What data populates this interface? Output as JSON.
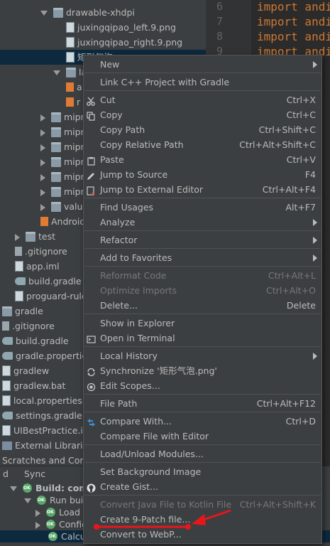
{
  "tree": {
    "rows": [
      {
        "text": "drawable-xhdpi",
        "indent": 57,
        "arrow": "down",
        "icon": "folder-icon"
      },
      {
        "text": "juxingqipao_left.9.png",
        "indent": 93,
        "arrow": "",
        "icon": "file-icon"
      },
      {
        "text": "juxingqipao_right.9.png",
        "indent": 93,
        "arrow": "",
        "icon": "file-icon"
      },
      {
        "text": "矩形气泡",
        "indent": 93,
        "arrow": "",
        "icon": "file-icon",
        "selected": true
      },
      {
        "text": "layout",
        "indent": 75,
        "arrow": "down",
        "icon": "folder-icon"
      },
      {
        "text": "a",
        "indent": 93,
        "arrow": "",
        "icon": "xml-file-icon"
      },
      {
        "text": "r",
        "indent": 93,
        "arrow": "",
        "icon": "xml-file-icon"
      },
      {
        "text": "mipmap",
        "indent": 57,
        "arrow": "right",
        "icon": "folder-icon"
      },
      {
        "text": "mipmap",
        "indent": 57,
        "arrow": "right",
        "icon": "folder-icon"
      },
      {
        "text": "mipmap",
        "indent": 57,
        "arrow": "right",
        "icon": "folder-icon"
      },
      {
        "text": "mipmap",
        "indent": 57,
        "arrow": "right",
        "icon": "folder-icon"
      },
      {
        "text": "mipmap",
        "indent": 57,
        "arrow": "right",
        "icon": "folder-icon"
      },
      {
        "text": "mipmap",
        "indent": 57,
        "arrow": "right",
        "icon": "folder-icon"
      },
      {
        "text": "values",
        "indent": 57,
        "arrow": "right",
        "icon": "folder-icon"
      },
      {
        "text": "AndroidManifest.xml",
        "indent": 57,
        "arrow": "",
        "icon": "manifest-icon"
      },
      {
        "text": "test",
        "indent": 21,
        "arrow": "right",
        "icon": "folder-icon"
      },
      {
        "text": ".gitignore",
        "indent": 21,
        "arrow": "",
        "icon": "git-file-icon"
      },
      {
        "text": "app.iml",
        "indent": 21,
        "arrow": "",
        "icon": "file-icon"
      },
      {
        "text": "build.gradle",
        "indent": 21,
        "arrow": "",
        "icon": "gradle-icon"
      },
      {
        "text": "proguard-rules.pro",
        "indent": 21,
        "arrow": "",
        "icon": "file-icon"
      },
      {
        "text": "gradle",
        "indent": 3,
        "arrow": "",
        "icon": "folder-icon"
      },
      {
        "text": ".gitignore",
        "indent": 3,
        "arrow": "",
        "icon": "git-file-icon"
      },
      {
        "text": "build.gradle",
        "indent": 3,
        "arrow": "",
        "icon": "gradle-icon"
      },
      {
        "text": "gradle.properties",
        "indent": 3,
        "arrow": "",
        "icon": "gradle-icon"
      },
      {
        "text": "gradlew",
        "indent": 3,
        "arrow": "",
        "icon": "file-icon"
      },
      {
        "text": "gradlew.bat",
        "indent": 3,
        "arrow": "",
        "icon": "file-icon"
      },
      {
        "text": "local.properties",
        "indent": 3,
        "arrow": "",
        "icon": "file-icon"
      },
      {
        "text": "settings.gradle",
        "indent": 3,
        "arrow": "",
        "icon": "gradle-icon"
      },
      {
        "text": "UIBestPractice.iml",
        "indent": 3,
        "arrow": "",
        "icon": "file-icon"
      },
      {
        "text": "External Libraries",
        "indent": 3,
        "arrow": "",
        "icon": "libraries-icon"
      },
      {
        "text": "Scratches and Consoles",
        "indent": 3,
        "arrow": "",
        "icon": ""
      }
    ]
  },
  "editor": {
    "lines": [
      {
        "num": "6",
        "code": "import andi"
      },
      {
        "num": "7",
        "code": "import andi"
      },
      {
        "num": "8",
        "code": "import andi"
      },
      {
        "num": "9",
        "code": "import andi"
      }
    ]
  },
  "bottom_tabs": {
    "left": "d",
    "sync": "Sync"
  },
  "run": {
    "rows": [
      {
        "text": "Build: completed",
        "indent": 14,
        "arrow": "down",
        "bold": true
      },
      {
        "text": "Run build",
        "indent": 34,
        "arrow": "down",
        "bold": false
      },
      {
        "text": "Load build",
        "indent": 50,
        "arrow": "right",
        "bold": false
      },
      {
        "text": "Configure build",
        "indent": 50,
        "arrow": "right",
        "bold": false
      },
      {
        "text": "Calculate task graph",
        "indent": 50,
        "arrow": "",
        "bold": false,
        "selected": true
      }
    ]
  },
  "menu": {
    "items": [
      {
        "label": "New",
        "shortcut": "",
        "submenu": true,
        "icon": ""
      },
      {
        "sep": true
      },
      {
        "label": "Link C++ Project with Gradle",
        "shortcut": "",
        "icon": ""
      },
      {
        "sep": true
      },
      {
        "label": "Cut",
        "shortcut": "Ctrl+X",
        "icon": "scissors-icon"
      },
      {
        "label": "Copy",
        "shortcut": "Ctrl+C",
        "icon": "copy-icon"
      },
      {
        "label": "Copy Path",
        "shortcut": "Ctrl+Shift+C",
        "icon": ""
      },
      {
        "label": "Copy Relative Path",
        "shortcut": "Ctrl+Alt+Shift+C",
        "icon": ""
      },
      {
        "label": "Paste",
        "shortcut": "Ctrl+V",
        "icon": "paste-icon"
      },
      {
        "label": "Jump to Source",
        "shortcut": "F4",
        "icon": "pencil-icon"
      },
      {
        "label": "Jump to External Editor",
        "shortcut": "Ctrl+Alt+F4",
        "icon": "external-editor-icon"
      },
      {
        "sep": true
      },
      {
        "label": "Find Usages",
        "shortcut": "Alt+F7",
        "icon": ""
      },
      {
        "label": "Analyze",
        "shortcut": "",
        "submenu": true,
        "icon": ""
      },
      {
        "sep": true
      },
      {
        "label": "Refactor",
        "shortcut": "",
        "submenu": true,
        "icon": ""
      },
      {
        "sep": true
      },
      {
        "label": "Add to Favorites",
        "shortcut": "",
        "submenu": true,
        "icon": ""
      },
      {
        "sep": true
      },
      {
        "label": "Reformat Code",
        "shortcut": "Ctrl+Alt+L",
        "disabled": true,
        "icon": ""
      },
      {
        "label": "Optimize Imports",
        "shortcut": "Ctrl+Alt+O",
        "disabled": true,
        "icon": ""
      },
      {
        "label": "Delete...",
        "shortcut": "Delete",
        "icon": ""
      },
      {
        "sep": true
      },
      {
        "label": "Show in Explorer",
        "shortcut": "",
        "icon": ""
      },
      {
        "label": "Open in Terminal",
        "shortcut": "",
        "icon": "terminal-icon"
      },
      {
        "sep": true
      },
      {
        "label": "Local History",
        "shortcut": "",
        "submenu": true,
        "icon": ""
      },
      {
        "label": "Synchronize '矩形气泡.png'",
        "shortcut": "",
        "icon": "sync-icon"
      },
      {
        "label": "Edit Scopes...",
        "shortcut": "",
        "icon": "scopes-icon"
      },
      {
        "sep": true
      },
      {
        "label": "File Path",
        "shortcut": "Ctrl+Alt+F12",
        "icon": ""
      },
      {
        "sep": true
      },
      {
        "label": "Compare With...",
        "shortcut": "Ctrl+D",
        "icon": "compare-icon"
      },
      {
        "label": "Compare File with Editor",
        "shortcut": "",
        "icon": ""
      },
      {
        "sep": true
      },
      {
        "label": "Load/Unload Modules...",
        "shortcut": "",
        "icon": ""
      },
      {
        "sep": true
      },
      {
        "label": "Set Background Image",
        "shortcut": "",
        "icon": ""
      },
      {
        "label": "Create Gist...",
        "shortcut": "",
        "icon": "github-icon"
      },
      {
        "sep": true
      },
      {
        "label": "Convert Java File to Kotlin File",
        "shortcut": "Ctrl+Alt+Shift+K",
        "disabled": true,
        "icon": ""
      },
      {
        "label": "Create 9-Patch file...",
        "shortcut": "",
        "icon": ""
      },
      {
        "label": "Convert to WebP...",
        "shortcut": "",
        "icon": ""
      }
    ]
  },
  "colors": {
    "annotation": "#e8161a",
    "menu_bg": "#3c3f41",
    "selection": "#0d293e"
  }
}
